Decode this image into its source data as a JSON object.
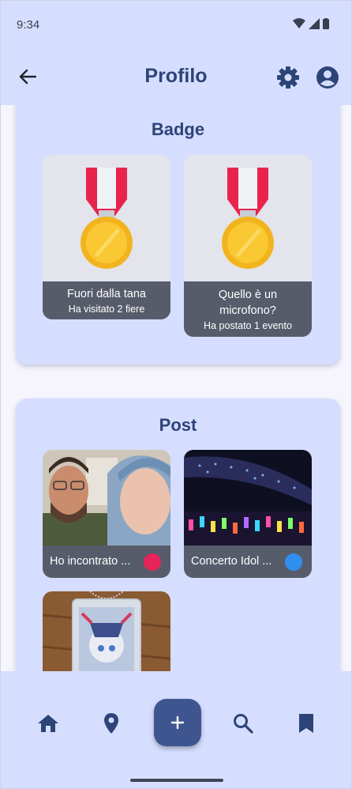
{
  "status_bar": {
    "time": "9:34"
  },
  "app_bar": {
    "title": "Profilo"
  },
  "badges": {
    "title": "Badge",
    "items": [
      {
        "title": "Fuori dalla tana",
        "subtitle": "Ha visitato 2 fiere"
      },
      {
        "title": "Quello è un microfono?",
        "subtitle": "Ha postato 1 evento"
      }
    ]
  },
  "posts": {
    "title": "Post",
    "items": [
      {
        "caption": "Ho incontrato ...",
        "dot_color": "#e8245a"
      },
      {
        "caption": "Concerto Idol ...",
        "dot_color": "#2f8ff0"
      },
      {
        "caption": ""
      }
    ]
  },
  "colors": {
    "accent": "#3f5590",
    "surface": "#d6deff",
    "title": "#2d4478"
  },
  "icons": {
    "back": "arrow-back-icon",
    "settings": "gear-icon",
    "account": "account-circle-icon",
    "home": "home-icon",
    "location": "location-pin-icon",
    "add": "plus-icon",
    "search": "search-icon",
    "bookmark": "bookmark-icon"
  }
}
